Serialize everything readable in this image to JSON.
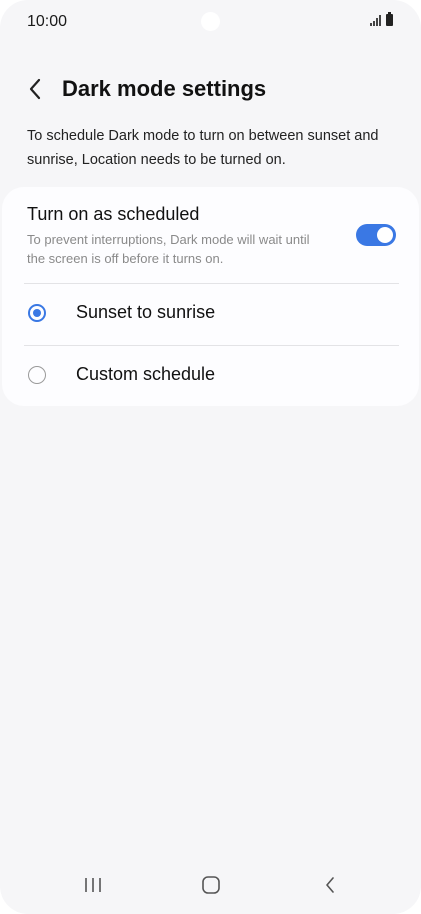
{
  "status_bar": {
    "time": "10:00",
    "icons": [
      "signal-icon",
      "battery-icon"
    ]
  },
  "header": {
    "back_icon": "chevron-left-icon",
    "title": "Dark mode settings"
  },
  "description": "To schedule Dark mode to turn on between sunset and sunrise, Location needs to be turned on.",
  "schedule_card": {
    "toggle": {
      "title": "Turn on as scheduled",
      "subtitle": "To prevent interruptions, Dark mode will wait until the screen is off before it turns on.",
      "state": "on"
    },
    "options": [
      {
        "label": "Sunset to sunrise",
        "selected": true
      },
      {
        "label": "Custom schedule",
        "selected": false
      }
    ]
  },
  "nav_bar": {
    "icons": [
      "recent-apps-icon",
      "home-icon",
      "back-icon"
    ]
  },
  "colors": {
    "accent": "#3a78e4",
    "background": "#f6f6f8",
    "card": "#fdfdff"
  }
}
